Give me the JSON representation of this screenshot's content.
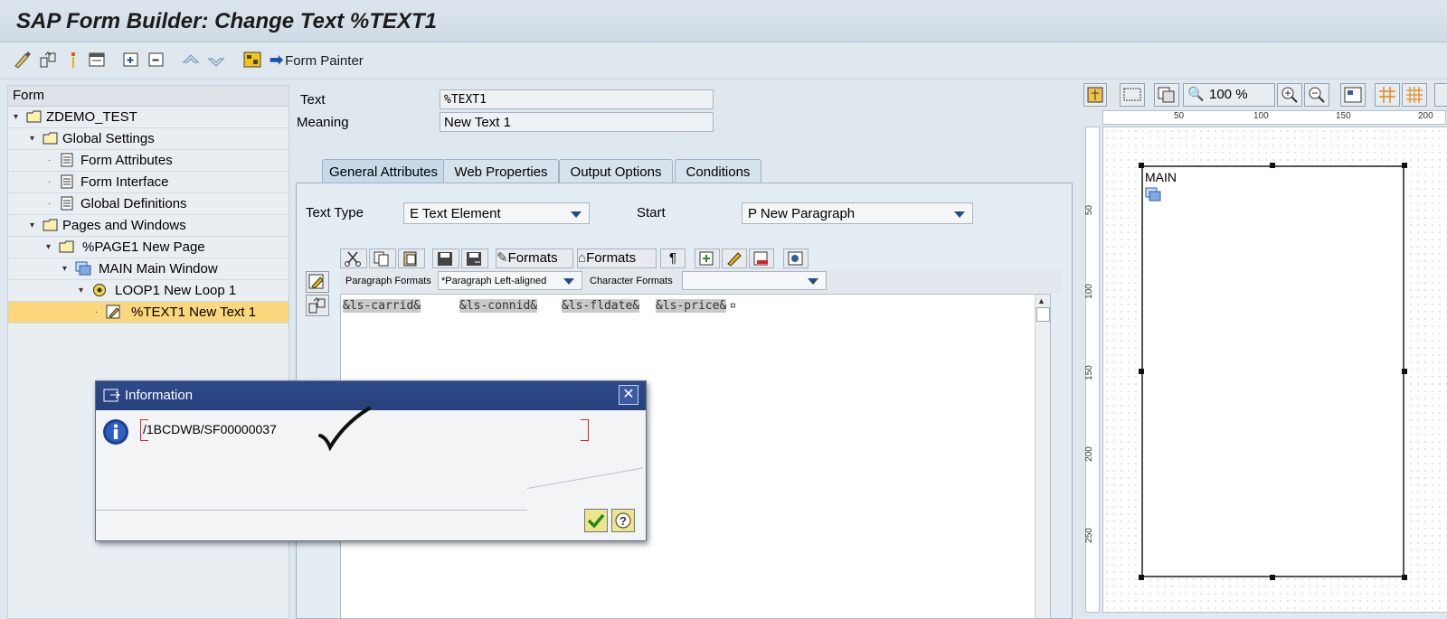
{
  "window": {
    "title": "SAP Form Builder: Change Text %TEXT1"
  },
  "toolbar": {
    "form_painter_label": "Form Painter",
    "icons": [
      "display-change-icon",
      "switch-icon",
      "check-icon",
      "test-icon",
      "expand-icon",
      "collapse-icon",
      "upload-icon",
      "download-icon",
      "layout-icon",
      "arrow-right-icon"
    ]
  },
  "tree": {
    "header": "Form",
    "nodes": [
      {
        "label": "ZDEMO_TEST"
      },
      {
        "label": "Global Settings"
      },
      {
        "label": "Form Attributes"
      },
      {
        "label": "Form Interface"
      },
      {
        "label": "Global Definitions"
      },
      {
        "label": "Pages and Windows"
      },
      {
        "label": "%PAGE1 New Page"
      },
      {
        "label": "MAIN Main Window"
      },
      {
        "label": "LOOP1 New Loop 1"
      },
      {
        "label": "%TEXT1 New Text 1"
      }
    ]
  },
  "header_fields": {
    "text_label": "Text",
    "text_value": "%TEXT1",
    "meaning_label": "Meaning",
    "meaning_value": "New Text 1"
  },
  "tabs": [
    "General Attributes",
    "Web Properties",
    "Output Options",
    "Conditions"
  ],
  "general": {
    "text_type_label": "Text Type",
    "text_type_value": "E Text Element",
    "start_label": "Start",
    "start_value": "P New Paragraph"
  },
  "editor": {
    "formats_button_1": "Formats",
    "formats_button_2": "Formats",
    "paragraph_mark": "¶",
    "paragraph_formats_label": "Paragraph Formats",
    "paragraph_formats_value": "*Paragraph Left-aligned",
    "character_formats_label": "Character Formats",
    "character_formats_value": "",
    "fields": [
      "&ls-carrid&",
      "&ls-connid&",
      "&ls-fldate&",
      "&ls-price&"
    ],
    "field_end_mark": "¤"
  },
  "painter": {
    "zoom": "100 %",
    "ruler_h": [
      "50",
      "100",
      "150",
      "200"
    ],
    "ruler_v": [
      "50",
      "100",
      "150",
      "200",
      "250"
    ],
    "window_label": "MAIN"
  },
  "dialog": {
    "title": "Information",
    "message": "/1BCDWB/SF00000037",
    "colors": {
      "header": "#27417c",
      "info_icon": "#1c3f94"
    }
  }
}
